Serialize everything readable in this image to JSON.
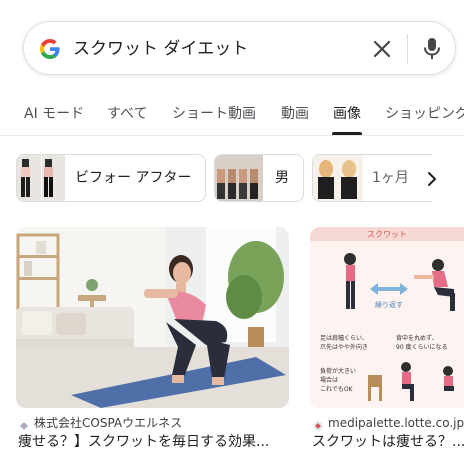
{
  "search": {
    "query": "スクワット ダイエット",
    "logo_icon": "google-g-logo",
    "clear_icon": "close-icon",
    "voice_icon": "microphone-icon"
  },
  "tabs": [
    {
      "label": "AI モード"
    },
    {
      "label": "すべて"
    },
    {
      "label": "ショート動画"
    },
    {
      "label": "動画"
    },
    {
      "label": "画像",
      "active": true
    },
    {
      "label": "ショッピング"
    }
  ],
  "chips": [
    {
      "label": "ビフォー アフター"
    },
    {
      "label": "男"
    },
    {
      "label": "1ヶ月"
    }
  ],
  "chips_next_icon": "chevron-right-icon",
  "results": [
    {
      "source": "株式会社COSPAウエルネス",
      "title": "痩せる？】スクワットを毎日する効果..."
    },
    {
      "source": "medipalette.lotte.co.jp",
      "title": "スクワットは痩せる？..."
    }
  ],
  "illustration_text": {
    "header": "スクワット",
    "repeat": "繰り返す",
    "left_note": [
      "足は肩幅くらい、",
      "爪先はやや外向き"
    ],
    "right_note": [
      "背中を丸めず、",
      "90 度くらいになる"
    ],
    "bottom_note": [
      "負荷が大きい",
      "場合は",
      "これでもOK"
    ]
  },
  "colors": {
    "accent": "#202124",
    "border": "#dadce0",
    "secondary_text": "#4d5156"
  }
}
